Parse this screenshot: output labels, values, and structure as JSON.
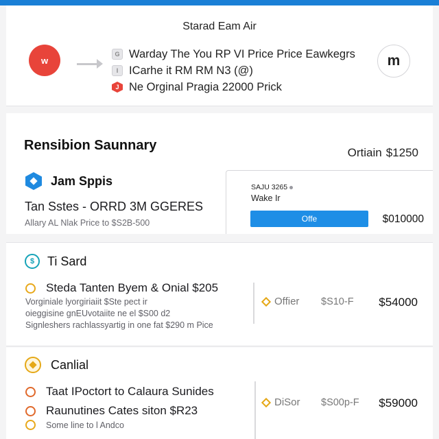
{
  "header": {
    "title": "Starad Eam Air",
    "avatar_left": "w",
    "avatar_right": "m",
    "lines": [
      {
        "icon": "G",
        "text": "Warday The You RP VI Price Price Eawkegrs"
      },
      {
        "icon": "I",
        "text": "ICarhe it RM RM N3 (@)"
      },
      {
        "icon": "J",
        "text": "Ne Orginal Pragia 22000 Prick"
      }
    ]
  },
  "summary": {
    "title": "Rensibion Saunnary",
    "right_label": "Ortiain",
    "right_amount": "$1250",
    "vendor": "Jam Sppis",
    "line1": "Tan Sstes - ORRD 3M GGERES",
    "line2": "Allary AL Nlak Price to $S2B-500",
    "offer": {
      "label_top": "SAJU 3265",
      "label_sub": "Wake Ir",
      "button": "Offe",
      "price": "$010000"
    }
  },
  "sections": [
    {
      "icon": "Ti",
      "title": "Ti Sard",
      "item": "Steda Tanten Byem & Onial $205",
      "subs": [
        "Vorginiale lyorgiriaiit $Ste pect ir",
        "oieggisine gnEUvotaiite ne el $S00 d2",
        "Signleshers rachlassyartig in one fat $290 m Pice"
      ],
      "offer": "Offier",
      "mid": "$S10-F",
      "price": "$54000"
    },
    {
      "icon": "",
      "title": "Canlial",
      "items": [
        "Taat IPoctort to Calaura Sunides",
        "Raunutines Cates siton $R23"
      ],
      "sub": "Some line to l Andco",
      "offer": "DiSor",
      "mid": "$S00p-F",
      "price": "$59000"
    }
  ],
  "colors": {
    "accent": "#1a7fd6",
    "button": "#1e8ee6",
    "avatar": "#e8443a",
    "gold": "#e5a817",
    "teal": "#16a3b8"
  }
}
